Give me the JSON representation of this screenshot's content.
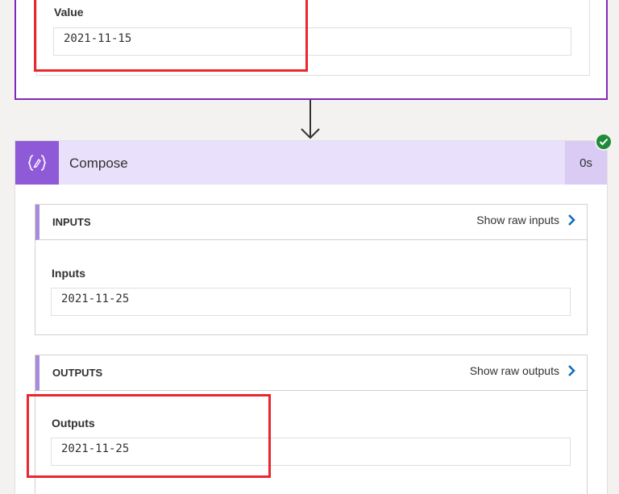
{
  "top_action": {
    "value_label": "Value",
    "value": "2021-11-15"
  },
  "compose": {
    "title": "Compose",
    "duration": "0s",
    "status_icon": "check-icon",
    "inputs_section": {
      "header": "INPUTS",
      "link": "Show raw inputs",
      "field_label": "Inputs",
      "field_value": "2021-11-25"
    },
    "outputs_section": {
      "header": "OUTPUTS",
      "link": "Show raw outputs",
      "field_label": "Outputs",
      "field_value": "2021-11-25"
    }
  },
  "colors": {
    "accent_purple": "#7f2ab6",
    "header_purple": "#e9e0fb",
    "icon_purple": "#8f5ad8",
    "highlight_red": "#e8282e",
    "success_green": "#1f8a3a",
    "link_blue": "#0f6cbd"
  }
}
